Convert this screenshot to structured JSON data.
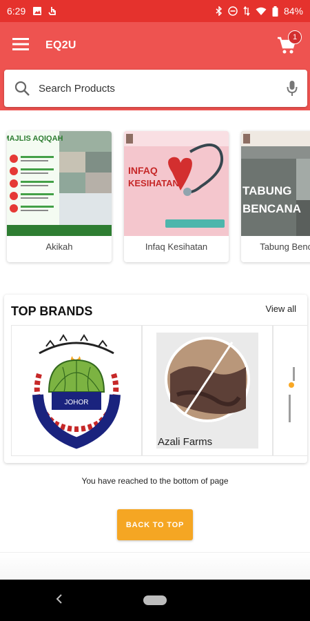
{
  "status_bar": {
    "time": "6:29",
    "battery": "84%"
  },
  "appbar": {
    "title": "EQ2U",
    "cart_count": "1"
  },
  "search": {
    "placeholder": "Search Products"
  },
  "categories": [
    {
      "label": "Akikah",
      "thumb_title": "MAJLIS AQIQAH"
    },
    {
      "label": "Infaq Kesihatan",
      "thumb_title": "INFAQ KESIHATAN"
    },
    {
      "label": "Tabung Bencana",
      "thumb_title": "TABUNG BENCANA"
    }
  ],
  "brands": {
    "heading": "TOP BRANDS",
    "view_all": "View all",
    "items": [
      {
        "name": "",
        "logo_text": "JOHOR"
      },
      {
        "name": "Azali Farms"
      }
    ]
  },
  "footer": {
    "bottom_message": "You have reached to the bottom of page",
    "back_to_top": "BACK TO TOP"
  },
  "colors": {
    "primary": "#ee5350",
    "status": "#e5322d",
    "accent": "#f5a623"
  }
}
